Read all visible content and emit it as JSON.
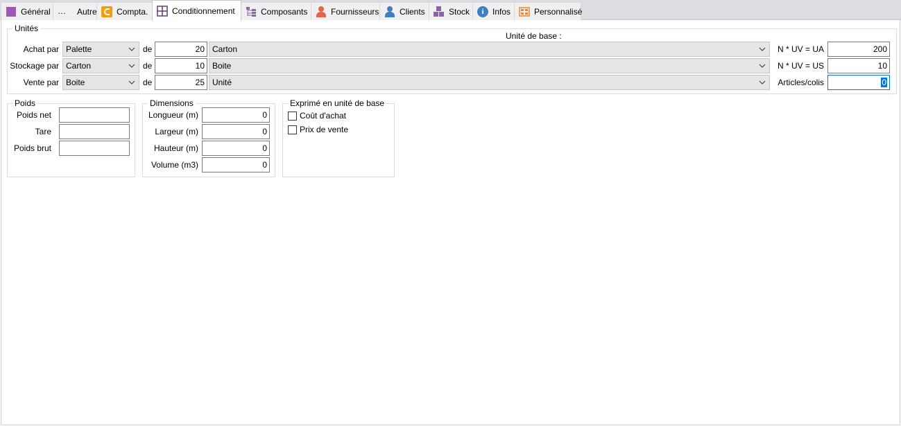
{
  "tabs": [
    {
      "label": "Général",
      "icon": "general-icon",
      "active": false
    },
    {
      "label": "Autre",
      "icon": "ellipsis-icon",
      "active": false
    },
    {
      "label": "Compta.",
      "icon": "compta-icon",
      "active": false
    },
    {
      "label": "Conditionnement",
      "icon": "grid-icon",
      "active": true
    },
    {
      "label": "Composants",
      "icon": "components-icon",
      "active": false
    },
    {
      "label": "Fournisseurs",
      "icon": "supplier-icon",
      "active": false
    },
    {
      "label": "Clients",
      "icon": "client-icon",
      "active": false
    },
    {
      "label": "Stock",
      "icon": "stock-icon",
      "active": false
    },
    {
      "label": "Infos",
      "icon": "info-icon",
      "active": false
    },
    {
      "label": "Personnalisé",
      "icon": "custom-icon",
      "active": false
    }
  ],
  "units": {
    "legend": "Unités",
    "base_unit_header": "Unité de base :",
    "rows": [
      {
        "label": "Achat par",
        "unit": "Palette",
        "de": "de",
        "qty": "20",
        "base_unit": "Carton",
        "ratio_label": "N * UV = UA",
        "ratio_value": "200"
      },
      {
        "label": "Stockage par",
        "unit": "Carton",
        "de": "de",
        "qty": "10",
        "base_unit": "Boite",
        "ratio_label": "N * UV = US",
        "ratio_value": "10"
      },
      {
        "label": "Vente par",
        "unit": "Boite",
        "de": "de",
        "qty": "25",
        "base_unit": "Unité",
        "ratio_label": "Articles/colis",
        "ratio_value": "0"
      }
    ]
  },
  "poids": {
    "legend": "Poids",
    "fields": [
      {
        "label": "Poids net",
        "value": ""
      },
      {
        "label": "Tare",
        "value": ""
      },
      {
        "label": "Poids brut",
        "value": ""
      }
    ]
  },
  "dimensions": {
    "legend": "Dimensions",
    "fields": [
      {
        "label": "Longueur (m)",
        "value": "0"
      },
      {
        "label": "Largeur (m)",
        "value": "0"
      },
      {
        "label": "Hauteur (m)",
        "value": "0"
      },
      {
        "label": "Volume (m3)",
        "value": "0"
      }
    ]
  },
  "base_unit_expr": {
    "legend": "Exprimé en unité de base",
    "checkboxes": [
      {
        "label": "Coût d'achat",
        "checked": false
      },
      {
        "label": "Prix de vente",
        "checked": false
      }
    ]
  },
  "colors": {
    "tabbar_bg": "#dcdce2",
    "accent": "#0078d7",
    "select_bg": "#e5e5e5"
  }
}
